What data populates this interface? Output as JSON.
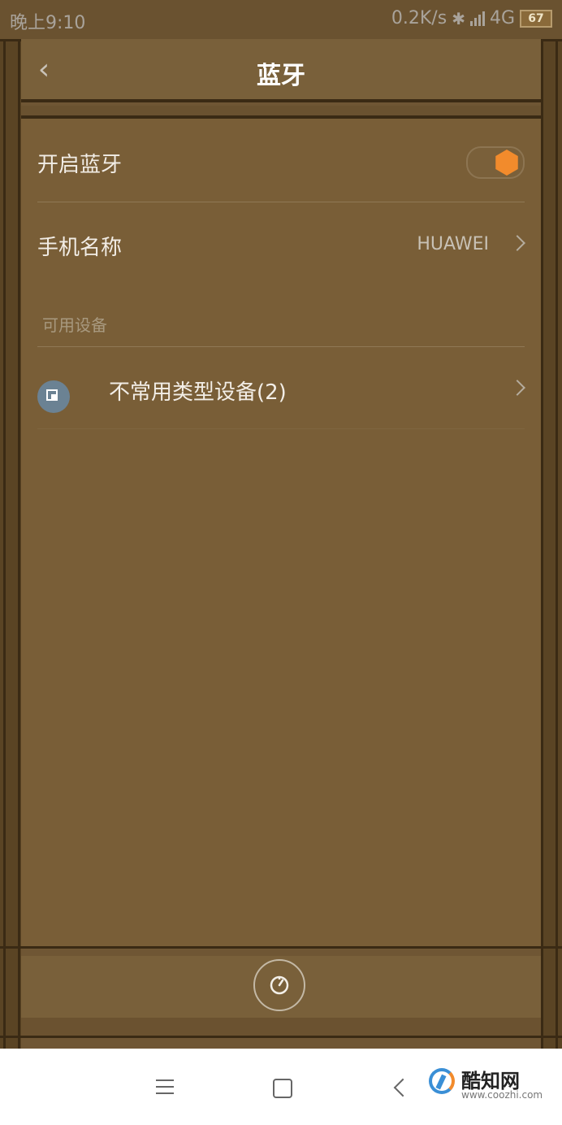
{
  "status": {
    "time": "晚上9:10",
    "speed": "0.2K/s",
    "network": "4G",
    "battery": "67"
  },
  "header": {
    "title": "蓝牙"
  },
  "settings": {
    "bluetooth_label": "开启蓝牙",
    "bluetooth_on": true,
    "phone_name_label": "手机名称",
    "phone_name_value": "HUAWEI"
  },
  "available": {
    "header": "可用设备",
    "devices": [
      {
        "label": "不常用类型设备(2)"
      }
    ]
  },
  "bottom": {
    "refresh_label": "刷新"
  },
  "watermark": {
    "title": "酷知网",
    "url": "www.coozhi.com"
  },
  "icons": [
    "back-icon",
    "bluetooth-icon",
    "signal-icon",
    "battery-icon",
    "chevron-right-icon",
    "device-icon",
    "refresh-icon",
    "menu-icon",
    "home-icon",
    "nav-back-icon"
  ],
  "colors": {
    "accent": "#f28b2c",
    "device_icon": "#6b8293"
  }
}
